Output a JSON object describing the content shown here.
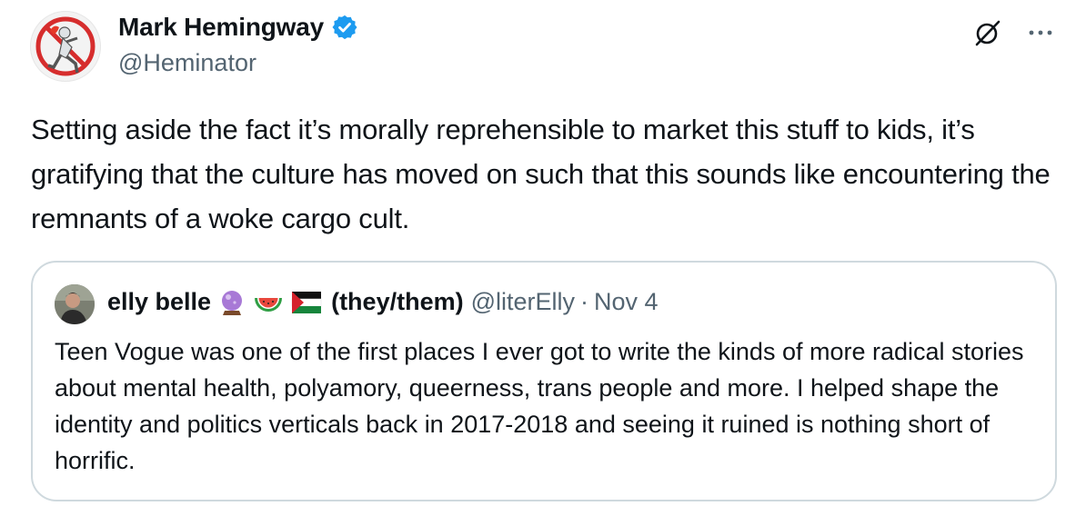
{
  "tweet": {
    "author_name": "Mark Hemingway",
    "handle": "@Heminator",
    "verified_icon": "verified-badge-icon",
    "text": "Setting aside the fact it’s morally reprehensible to market this stuff to kids, it’s gratifying that the culture has moved on such that this sounds like encountering the remnants of a woke cargo cult.",
    "actions": {
      "grok_icon": "grok-icon",
      "more_icon": "more-options-icon"
    }
  },
  "quote": {
    "author_name": "elly belle",
    "emojis": [
      "crystal-ball-emoji",
      "watermelon-emoji",
      "palestine-flag-emoji"
    ],
    "pronouns": "(they/them)",
    "handle": "@literElly",
    "separator": "·",
    "date": "Nov 4",
    "text": "Teen Vogue was one of the first places I ever got to write the kinds of more radical stories about mental health, polyamory, queerness, trans people and more. I helped shape the identity and politics verticals back in 2017-2018 and seeing it ruined is nothing short of horrific."
  },
  "colors": {
    "text": "#0f1419",
    "secondary": "#536471",
    "verified_blue": "#1d9bf0",
    "card_border": "#cfd9de"
  }
}
